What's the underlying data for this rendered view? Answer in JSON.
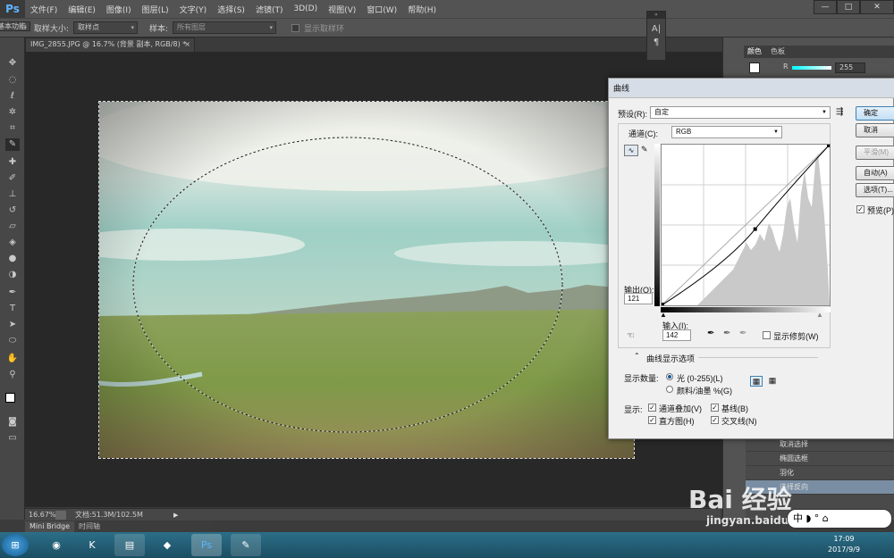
{
  "app": {
    "logo": "Ps"
  },
  "menu": [
    "文件(F)",
    "编辑(E)",
    "图像(I)",
    "图层(L)",
    "文字(Y)",
    "选择(S)",
    "滤镜(T)",
    "3D(D)",
    "视图(V)",
    "窗口(W)",
    "帮助(H)"
  ],
  "window_controls": {
    "minimize": "—",
    "restore": "□",
    "close": "✕"
  },
  "options": {
    "sample_size_label": "取样大小:",
    "sample_size_value": "取样点",
    "sample_label": "样本:",
    "sample_value": "所有图层",
    "show_ring_label": "显示取样环",
    "workspace": "基本功能"
  },
  "document": {
    "tab_title": "IMG_2855.JPG @ 16.7% (背景 副本, RGB/8) *",
    "tab_close": "×"
  },
  "status": {
    "zoom": "16.67%",
    "doc_size": "文档:51.3M/102.5M"
  },
  "bottom_tabs": [
    "Mini Bridge",
    "时间轴"
  ],
  "panels": {
    "color_tab": "颜色",
    "swatch_tab": "色板",
    "r_label": "R",
    "r_value": "255",
    "history": [
      "取消选择",
      "椭圆选框",
      "羽化",
      "选择反向"
    ],
    "history_selected": 3
  },
  "curves": {
    "title": "曲线",
    "preset_label": "预设(R):",
    "preset_value": "自定",
    "channel_label": "通道(C):",
    "channel_value": "RGB",
    "output_label": "输出(O):",
    "output_value": "121",
    "input_label": "输入(I):",
    "input_value": "142",
    "show_clipping": "显示修剪(W)",
    "display_options": "曲线显示选项",
    "show_amount_label": "显示数量:",
    "light_option": "光 (0-255)(L)",
    "pigment_option": "颜料/油墨 %(G)",
    "show_label": "显示:",
    "channel_overlay": "通道叠加(V)",
    "baseline": "基线(B)",
    "histogram": "直方图(H)",
    "intersection": "交叉线(N)",
    "buttons": {
      "ok": "确定",
      "cancel": "取消",
      "smooth": "平滑(M)",
      "auto": "自动(A)",
      "options": "选项(T)..."
    },
    "preview_label": "预览(P)",
    "point": {
      "input": 142,
      "output": 121
    }
  },
  "taskbar": {
    "time": "17:09",
    "date": "2017/9/9"
  },
  "watermark": {
    "brand": "Bai 经验",
    "url": "jingyan.baidu.com"
  },
  "ime": "中 ◗ ° ⌂"
}
